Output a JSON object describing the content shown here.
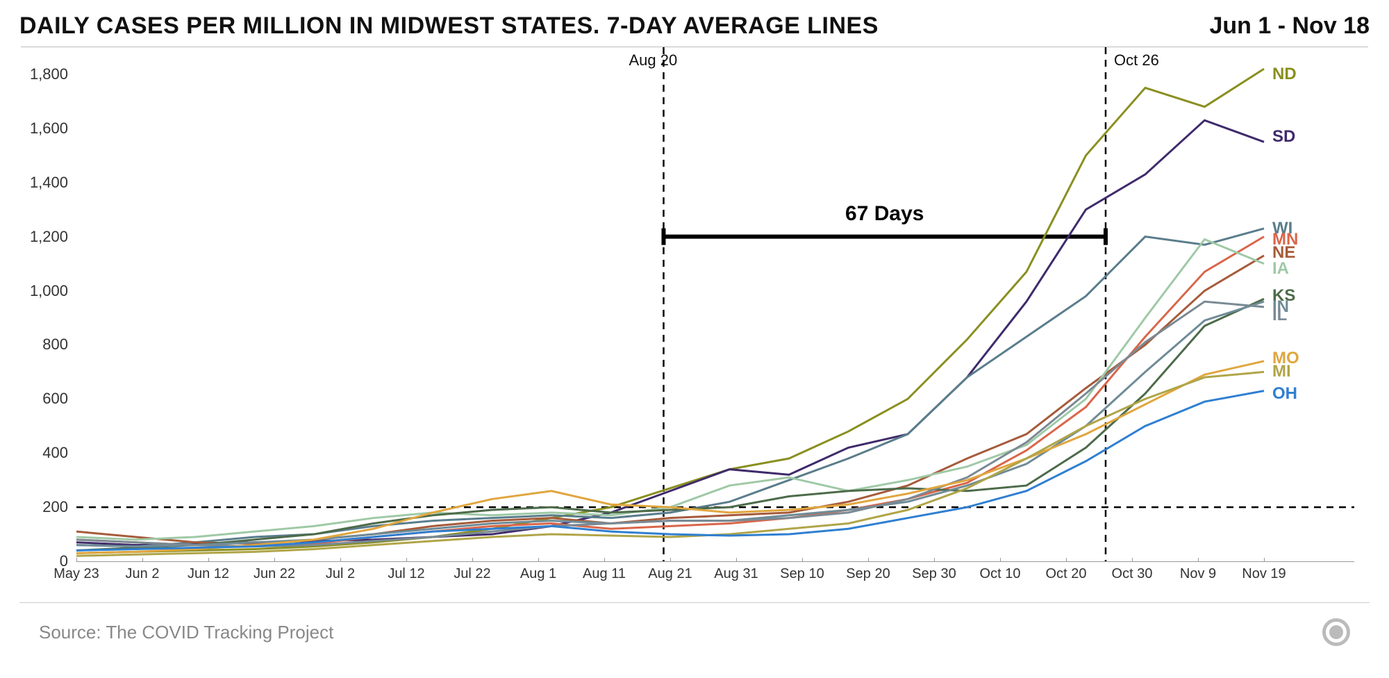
{
  "header": {
    "title": "DAILY CASES PER MILLION IN MIDWEST STATES. 7-DAY AVERAGE LINES",
    "date_range": "Jun 1 - Nov 18"
  },
  "footer": {
    "source": "Source: The COVID Tracking Project"
  },
  "annotations": {
    "vline1_label": "Aug 20",
    "vline2_label": "Oct 26",
    "days_label": "67 Days",
    "hline_y": 200,
    "vline1_x": "Aug 20",
    "vline2_x": "Oct 26",
    "bracket_y": 1200
  },
  "chart_data": {
    "type": "line",
    "title": "Daily Cases Per Million in Midwest States. 7-Day Average Lines",
    "xlabel": "",
    "ylabel": "",
    "ylim": [
      0,
      1900
    ],
    "y_ticks": [
      0,
      200,
      400,
      600,
      800,
      1000,
      1200,
      1400,
      1600,
      1800
    ],
    "x_categories": [
      "May 23",
      "Jun 2",
      "Jun 12",
      "Jun 22",
      "Jul 2",
      "Jul 12",
      "Jul 22",
      "Aug 1",
      "Aug 11",
      "Aug 21",
      "Aug 31",
      "Sep 10",
      "Sep 20",
      "Sep 30",
      "Oct 10",
      "Oct 20",
      "Oct 30",
      "Nov 9",
      "Nov 19"
    ],
    "series": [
      {
        "name": "ND",
        "label": "ND",
        "color": "#8a8f1f",
        "values": [
          30,
          35,
          40,
          45,
          55,
          70,
          90,
          120,
          160,
          200,
          270,
          340,
          380,
          480,
          600,
          820,
          1070,
          1500,
          1750,
          1680,
          1820
        ]
      },
      {
        "name": "SD",
        "label": "SD",
        "color": "#3f2a6b",
        "values": [
          70,
          60,
          65,
          70,
          75,
          80,
          90,
          100,
          130,
          180,
          260,
          340,
          320,
          420,
          470,
          680,
          960,
          1300,
          1430,
          1630,
          1550
        ]
      },
      {
        "name": "WI",
        "label": "WI",
        "color": "#5a7d8c",
        "values": [
          60,
          55,
          70,
          90,
          100,
          130,
          150,
          160,
          170,
          160,
          180,
          220,
          300,
          380,
          470,
          680,
          830,
          980,
          1200,
          1170,
          1230
        ]
      },
      {
        "name": "MN",
        "label": "MN",
        "color": "#d9664a",
        "values": [
          80,
          70,
          60,
          55,
          65,
          90,
          110,
          130,
          140,
          120,
          130,
          140,
          160,
          190,
          230,
          290,
          410,
          570,
          830,
          1070,
          1200
        ]
      },
      {
        "name": "NE",
        "label": "NE",
        "color": "#a65b3a",
        "values": [
          110,
          90,
          70,
          65,
          80,
          100,
          130,
          150,
          160,
          140,
          160,
          170,
          180,
          220,
          280,
          380,
          470,
          640,
          800,
          1000,
          1130
        ]
      },
      {
        "name": "IA",
        "label": "IA",
        "color": "#9fc9a6",
        "values": [
          90,
          80,
          90,
          110,
          130,
          160,
          180,
          170,
          180,
          170,
          200,
          280,
          310,
          260,
          300,
          350,
          430,
          600,
          900,
          1190,
          1100
        ]
      },
      {
        "name": "KS",
        "label": "KS",
        "color": "#4d6b4a",
        "values": [
          40,
          50,
          60,
          80,
          100,
          140,
          170,
          190,
          200,
          180,
          190,
          200,
          240,
          260,
          270,
          260,
          280,
          420,
          620,
          870,
          970
        ]
      },
      {
        "name": "IN",
        "label": "IN",
        "color": "#6f8b97",
        "values": [
          60,
          55,
          60,
          70,
          80,
          100,
          120,
          140,
          150,
          140,
          150,
          150,
          170,
          190,
          220,
          280,
          360,
          500,
          700,
          890,
          960
        ]
      },
      {
        "name": "IL",
        "label": "IL",
        "color": "#7a8a94",
        "values": [
          80,
          70,
          60,
          55,
          60,
          75,
          90,
          110,
          130,
          140,
          150,
          150,
          160,
          180,
          230,
          310,
          440,
          620,
          810,
          960,
          940
        ]
      },
      {
        "name": "MO",
        "label": "MO",
        "color": "#e0a63e",
        "values": [
          30,
          35,
          45,
          60,
          80,
          120,
          180,
          230,
          260,
          210,
          200,
          180,
          190,
          210,
          250,
          300,
          380,
          470,
          580,
          690,
          740
        ]
      },
      {
        "name": "MI",
        "label": "MI",
        "color": "#b0a548",
        "values": [
          20,
          25,
          30,
          35,
          45,
          60,
          75,
          90,
          100,
          95,
          90,
          100,
          120,
          140,
          190,
          270,
          380,
          500,
          600,
          680,
          700
        ]
      },
      {
        "name": "OH",
        "label": "OH",
        "color": "#2f7fd1",
        "values": [
          40,
          45,
          50,
          55,
          70,
          90,
          110,
          120,
          130,
          110,
          100,
          95,
          100,
          120,
          160,
          200,
          260,
          370,
          500,
          590,
          630
        ]
      }
    ],
    "series_label_y": {
      "ND": 1800,
      "SD": 1570,
      "WI": 1230,
      "MN": 1190,
      "NE": 1140,
      "IA": 1080,
      "KS": 980,
      "IN": 940,
      "IL": 910,
      "MO": 750,
      "MI": 700,
      "OH": 620
    }
  }
}
